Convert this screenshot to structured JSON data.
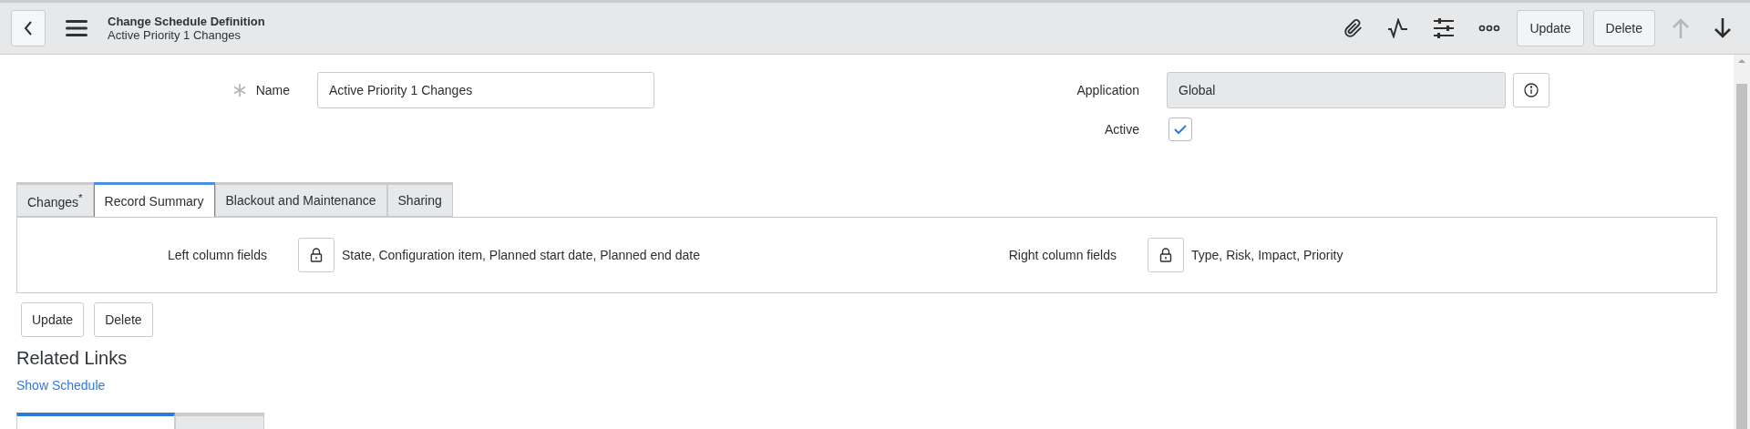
{
  "header": {
    "title": "Change Schedule Definition",
    "subtitle": "Active Priority 1 Changes",
    "buttons": [
      "Update",
      "Delete"
    ],
    "up_disabled": true,
    "down_disabled": false
  },
  "form": {
    "name": {
      "label": "Name",
      "value": "Active Priority 1 Changes",
      "required": true
    },
    "application": {
      "label": "Application",
      "value": "Global",
      "readonly": true
    },
    "active": {
      "label": "Active",
      "checked": true
    }
  },
  "tabs": [
    {
      "label": "Changes",
      "modified": true,
      "selected": false
    },
    {
      "label": "Record Summary",
      "modified": false,
      "selected": true
    },
    {
      "label": "Blackout and Maintenance",
      "modified": false,
      "selected": false
    },
    {
      "label": "Sharing",
      "modified": false,
      "selected": false
    }
  ],
  "modified_mark": "*",
  "tab_panel": {
    "fields": [
      {
        "label": "Left column fields",
        "value": "State, Configuration item, Planned start date, Planned end date"
      },
      {
        "label": "Right column fields",
        "value": "Type, Risk, Impact, Priority"
      }
    ]
  },
  "form_buttons": [
    "Update",
    "Delete"
  ],
  "related_links": {
    "title": "Related Links",
    "links": [
      "Show Schedule"
    ]
  },
  "related_tabs": [
    {
      "selected": true
    },
    {
      "selected": false
    }
  ]
}
